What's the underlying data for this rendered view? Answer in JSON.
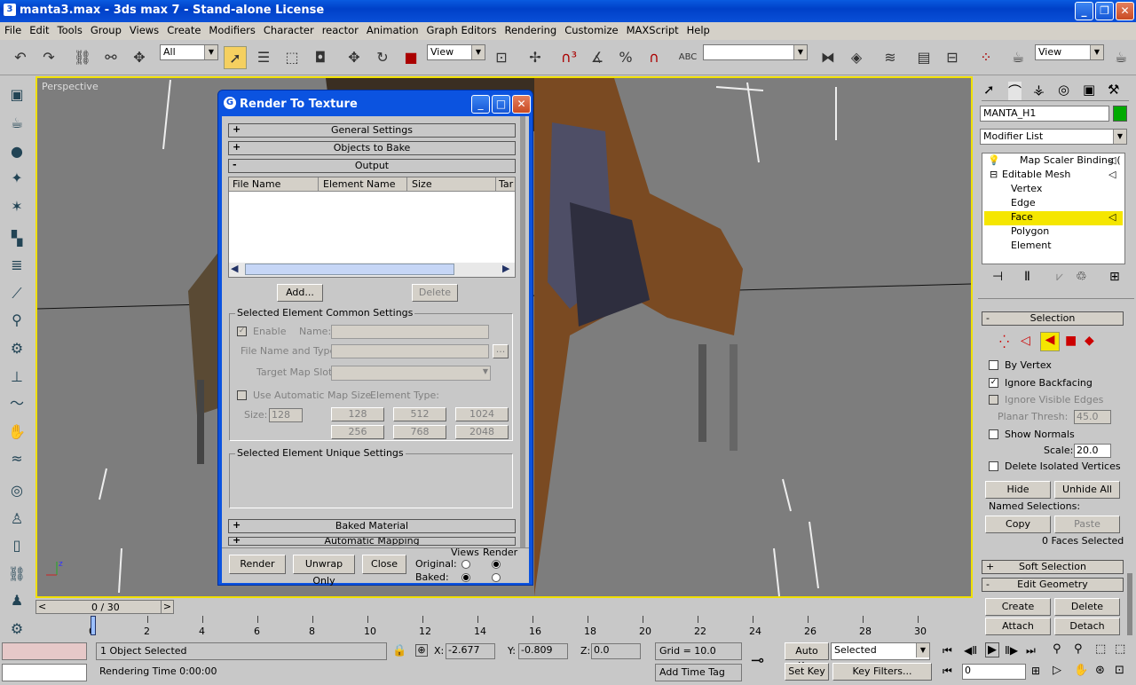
{
  "window": {
    "title": "manta3.max - 3ds max 7  - Stand-alone License"
  },
  "menu": [
    "File",
    "Edit",
    "Tools",
    "Group",
    "Views",
    "Create",
    "Modifiers",
    "Character",
    "reactor",
    "Animation",
    "Graph Editors",
    "Rendering",
    "Customize",
    "MAXScript",
    "Help"
  ],
  "toolbar": {
    "filter": "All",
    "refcoord": "View",
    "refcoord2": "View"
  },
  "viewport": {
    "label": "Perspective"
  },
  "dialog": {
    "title": "Render To Texture",
    "rollouts": {
      "general": "General Settings",
      "objects": "Objects to Bake",
      "output": "Output",
      "baked_material": "Baked Material",
      "auto_mapping": "Automatic Mapping"
    },
    "table_headers": [
      "File Name",
      "Element Name",
      "Size",
      "Tar"
    ],
    "add": "Add...",
    "delete": "Delete",
    "common": {
      "label": "Selected Element Common Settings",
      "enable": "Enable",
      "name": "Name:",
      "file_name_type": "File Name and Type:",
      "target_map_slot": "Target Map Slot:",
      "use_auto_size": "Use Automatic Map Size",
      "element_type": "Element Type:",
      "size_label": "Size:",
      "size_value": "128",
      "sizes": [
        "128",
        "512",
        "1024",
        "256",
        "768",
        "2048"
      ],
      "browse": "..."
    },
    "unique": {
      "label": "Selected Element Unique Settings"
    },
    "buttons": {
      "render": "Render",
      "unwrap": "Unwrap Only",
      "close": "Close"
    },
    "views_render": {
      "views": "Views",
      "render": "Render",
      "original": "Original:",
      "baked": "Baked:"
    }
  },
  "right": {
    "object_name": "MANTA_H1",
    "modifier_list": "Modifier List",
    "stack": [
      "Map Scaler Binding (",
      "Editable Mesh",
      "Vertex",
      "Edge",
      "Face",
      "Polygon",
      "Element"
    ],
    "selection": {
      "title": "Selection",
      "by_vertex": "By Vertex",
      "ignore_backfacing": "Ignore Backfacing",
      "ignore_visible": "Ignore Visible Edges",
      "planar_thresh": "Planar Thresh:",
      "planar_value": "45.0",
      "show_normals": "Show Normals",
      "scale": "Scale:",
      "scale_value": "20.0",
      "delete_isolated": "Delete Isolated Vertices",
      "hide": "Hide",
      "unhide_all": "Unhide All",
      "named_selections": "Named Selections:",
      "copy": "Copy",
      "paste": "Paste",
      "faces_selected": "0 Faces Selected"
    },
    "soft_selection": "Soft Selection",
    "edit_geometry": "Edit Geometry",
    "create": "Create",
    "delete": "Delete",
    "attach": "Attach",
    "detach": "Detach"
  },
  "timeline": {
    "frame": "0 / 30",
    "ticks": [
      "0",
      "2",
      "4",
      "6",
      "8",
      "10",
      "12",
      "14",
      "16",
      "18",
      "20",
      "22",
      "24",
      "26",
      "28",
      "30"
    ]
  },
  "status": {
    "selection": "1 Object Selected",
    "rendering_time": "Rendering Time  0:00:00",
    "x_label": "X:",
    "x": "-2.677",
    "y_label": "Y:",
    "y": "-0.809",
    "z_label": "Z:",
    "z": "0.0",
    "grid": "Grid = 10.0",
    "add_time_tag": "Add Time Tag",
    "auto_key": "Auto Key",
    "set_key": "Set Key",
    "selected": "Selected",
    "key_filters": "Key Filters...",
    "frame_value": "0"
  }
}
